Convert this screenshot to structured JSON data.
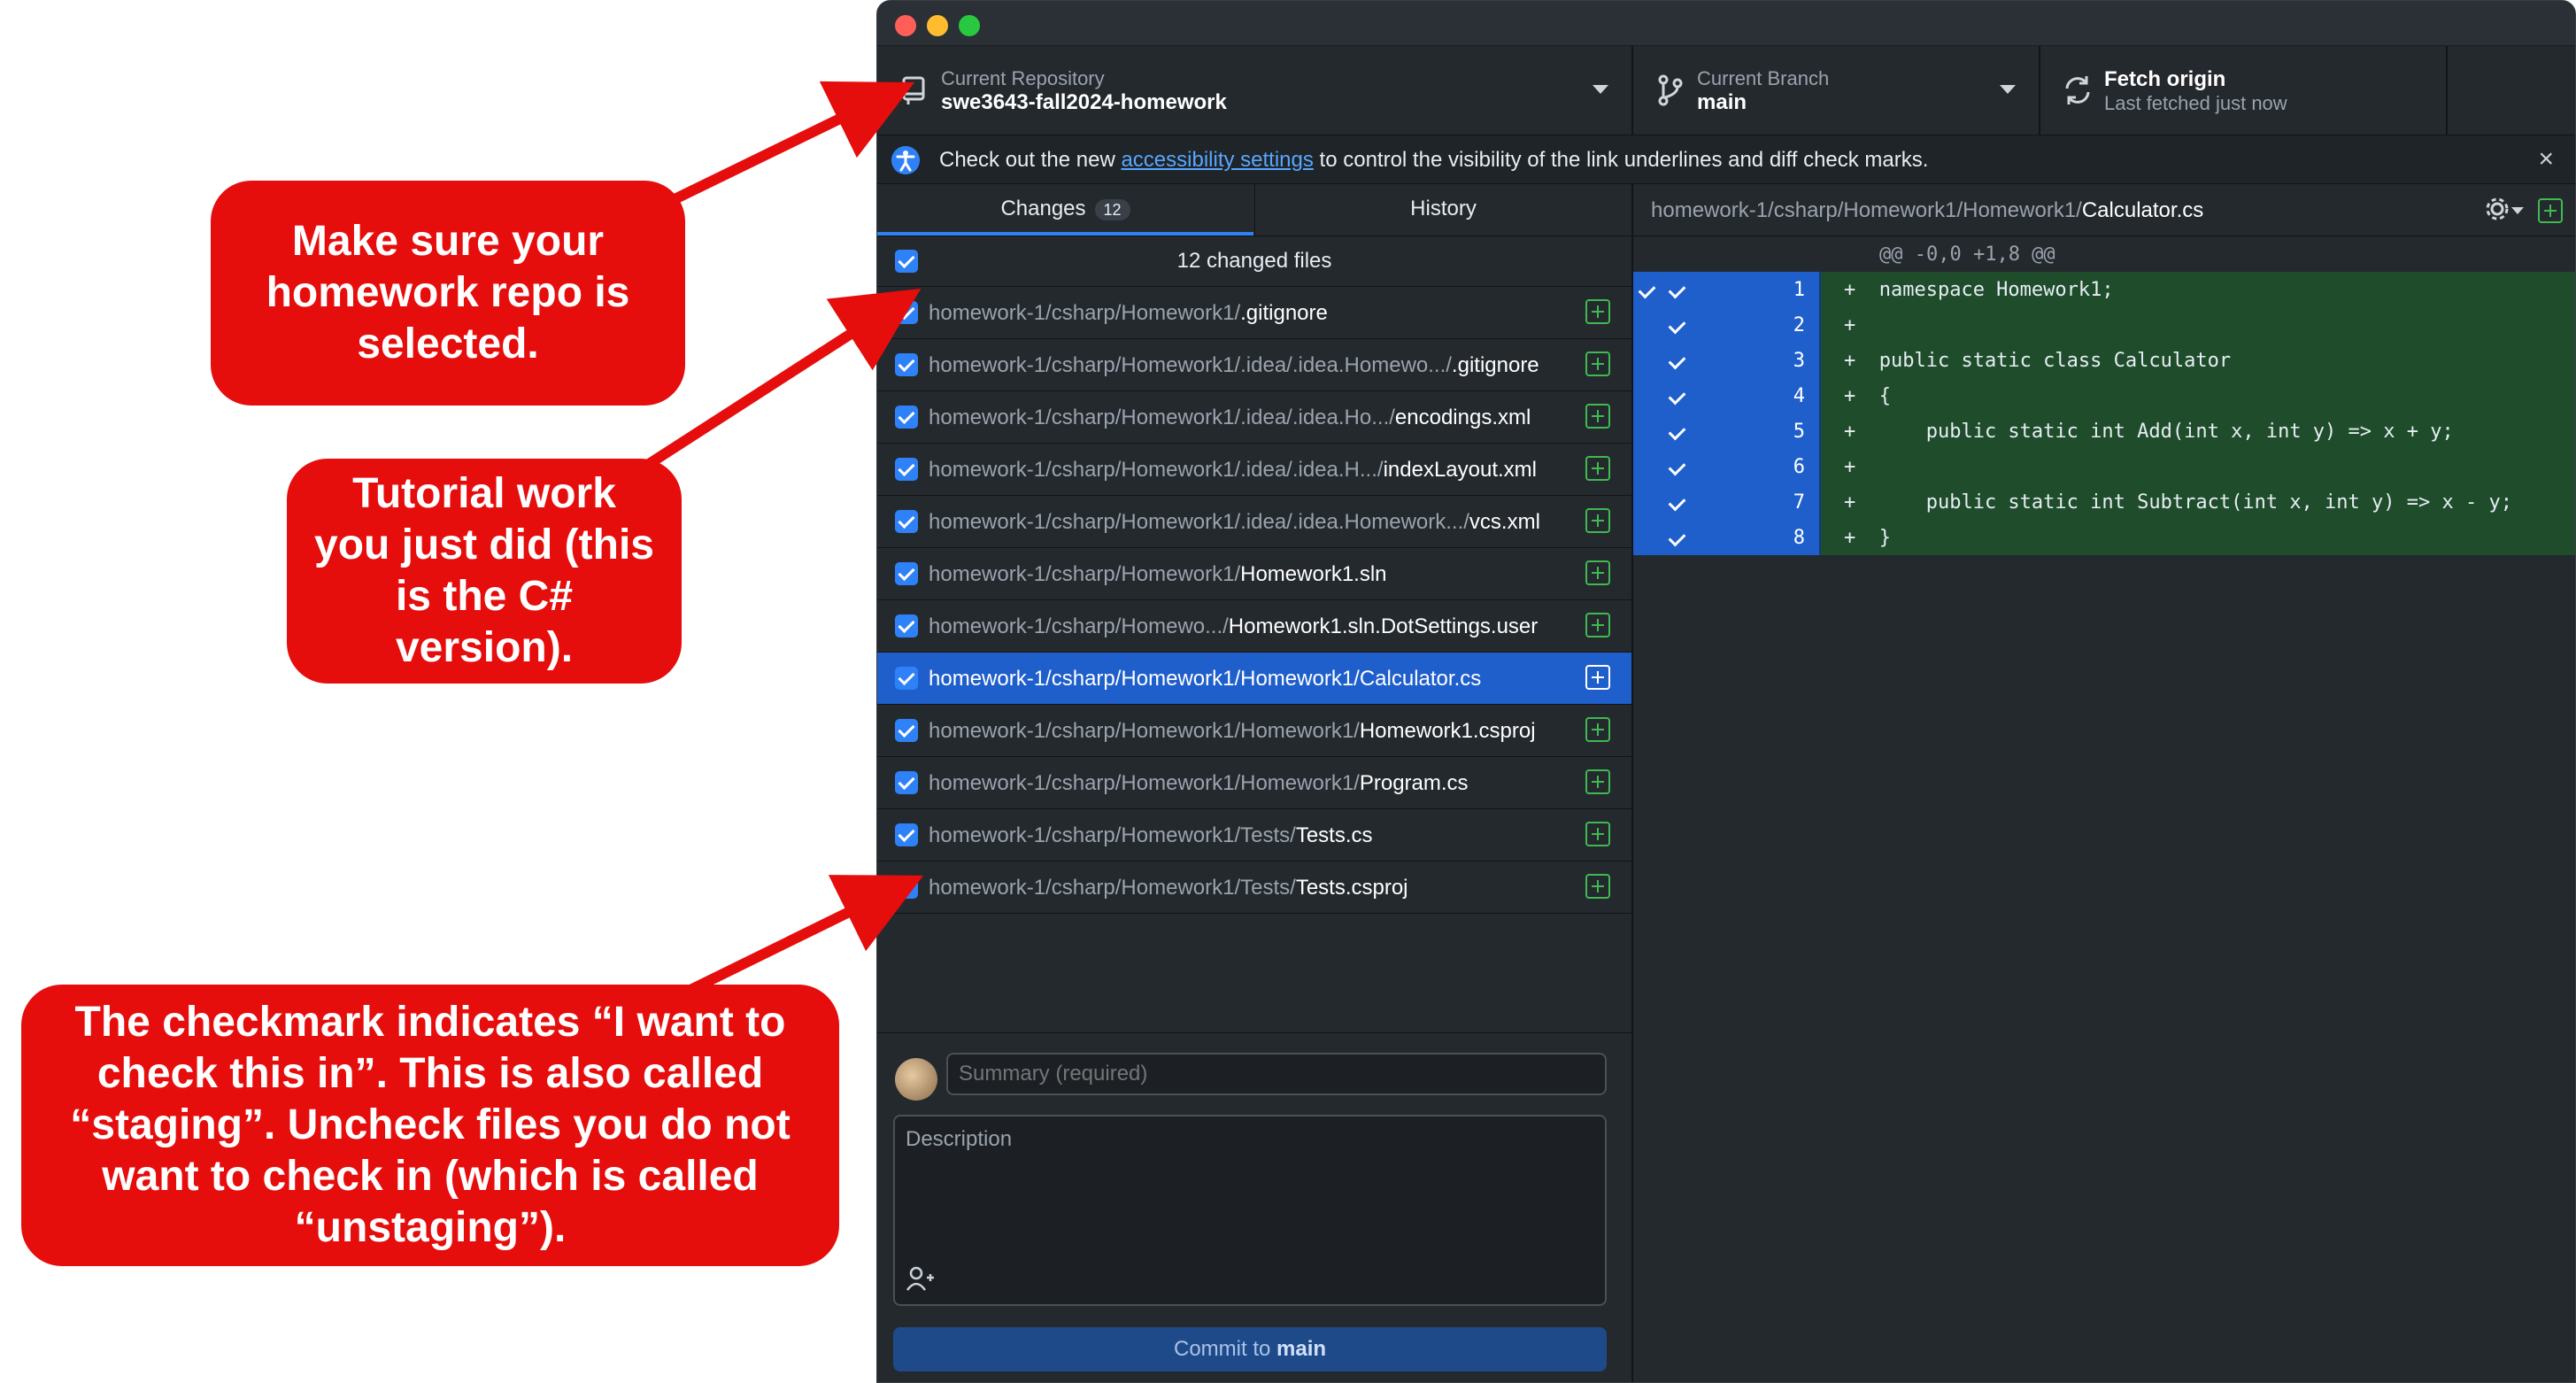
{
  "annotations": {
    "repo": "Make sure your homework repo is selected.",
    "tutorial": "Tutorial work you just did (this is the C# version).",
    "checkmark": "The checkmark indicates “I want to check this in”. This is also called “staging”. Uncheck files you do not want to check in (which is called “unstaging”)."
  },
  "toolbar": {
    "repo_label": "Current Repository",
    "repo_value": "swe3643-fall2024-homework",
    "branch_label": "Current Branch",
    "branch_value": "main",
    "fetch_title": "Fetch origin",
    "fetch_sub": "Last fetched just now"
  },
  "banner": {
    "prefix": "Check out the new ",
    "link": "accessibility settings",
    "suffix": " to control the visibility of the link underlines and diff check marks.",
    "close": "×"
  },
  "tabs": {
    "changes": "Changes",
    "changes_count": "12",
    "history": "History"
  },
  "changes": {
    "header": "12 changed files",
    "files": [
      {
        "dir": "homework-1/csharp/Homework1/",
        "name": ".gitignore"
      },
      {
        "dir": "homework-1/csharp/Homework1/.idea/.idea.Homewo.../",
        "name": ".gitignore"
      },
      {
        "dir": "homework-1/csharp/Homework1/.idea/.idea.Ho.../",
        "name": "encodings.xml"
      },
      {
        "dir": "homework-1/csharp/Homework1/.idea/.idea.H.../",
        "name": "indexLayout.xml"
      },
      {
        "dir": "homework-1/csharp/Homework1/.idea/.idea.Homework.../",
        "name": "vcs.xml"
      },
      {
        "dir": "homework-1/csharp/Homework1/",
        "name": "Homework1.sln"
      },
      {
        "dir": "homework-1/csharp/Homewo.../",
        "name": "Homework1.sln.DotSettings.user"
      },
      {
        "dir": "homework-1/csharp/Homework1/Homework1/",
        "name": "Calculator.cs"
      },
      {
        "dir": "homework-1/csharp/Homework1/Homework1/",
        "name": "Homework1.csproj"
      },
      {
        "dir": "homework-1/csharp/Homework1/Homework1/",
        "name": "Program.cs"
      },
      {
        "dir": "homework-1/csharp/Homework1/Tests/",
        "name": "Tests.cs"
      },
      {
        "dir": "homework-1/csharp/Homework1/Tests/",
        "name": "Tests.csproj"
      }
    ]
  },
  "commit": {
    "summary_placeholder": "Summary (required)",
    "description_placeholder": "Description",
    "button_prefix": "Commit to ",
    "button_branch": "main"
  },
  "diff": {
    "path_dir": "homework-1/csharp/Homework1/Homework1/",
    "path_file": "Calculator.cs",
    "hunk": "@@ -0,0 +1,8 @@",
    "lines": [
      {
        "num": "1",
        "code": "+  namespace Homework1;"
      },
      {
        "num": "2",
        "code": "+"
      },
      {
        "num": "3",
        "code": "+  public static class Calculator"
      },
      {
        "num": "4",
        "code": "+  {"
      },
      {
        "num": "5",
        "code": "+      public static int Add(int x, int y) => x + y;"
      },
      {
        "num": "6",
        "code": "+"
      },
      {
        "num": "7",
        "code": "+      public static int Subtract(int x, int y) => x - y;"
      },
      {
        "num": "8",
        "code": "+  }"
      }
    ]
  },
  "colors": {
    "accent": "#2f81f7",
    "added_bg": "#1f4d2b",
    "callout": "#e60d0d"
  }
}
